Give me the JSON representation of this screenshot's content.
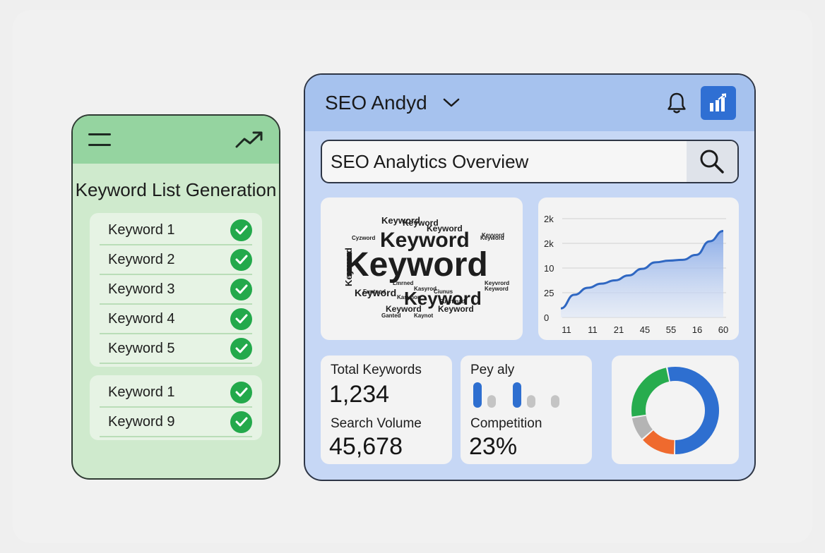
{
  "phone": {
    "title": "Keyword List Generation",
    "group1": [
      "Keyword 1",
      "Keyword 2",
      "Keyword 3",
      "Keyword 4",
      "Keyword 5"
    ],
    "group2": [
      "Keyword 1",
      "Keyword 9"
    ],
    "accent": "#95d4a0",
    "check_color": "#23a94b"
  },
  "dashboard": {
    "app_title": "SEO Andyd",
    "search_value": "SEO Analytics Overview",
    "word_cloud": {
      "main": "Keyword",
      "secondary": [
        "Keyword",
        "Keyword",
        "Keyword",
        "Keyword",
        "Keyword",
        "Keyword",
        "Keyword",
        "Keyword",
        "Keyword"
      ],
      "small": [
        "Cyzword",
        "Keyvord",
        "Ganted",
        "Keyword",
        "Keyvrord",
        "Keyword",
        "Lmrned",
        "Kasyrod",
        "Ciunus",
        "Funtnod",
        "Kasynor",
        "Fuyrtinad",
        "Kaynot"
      ]
    },
    "stats": {
      "total_keywords_label": "Total Keywords",
      "total_keywords_value": "1,234",
      "search_volume_label": "Search Volume",
      "search_volume_value": "45,678",
      "pay_label": "Pey aly",
      "competition_label": "Competition",
      "competition_value": "23%"
    },
    "accent": "#2f6fd3"
  },
  "chart_data": [
    {
      "type": "area",
      "y_tick_labels": [
        "2k",
        "2k",
        "10",
        "25",
        "0"
      ],
      "x": [
        "11",
        "11",
        "21",
        "45",
        "55",
        "16",
        "60"
      ],
      "values": [
        0.22,
        0.55,
        0.72,
        0.82,
        0.9,
        1.02,
        1.18,
        1.34,
        1.38,
        1.4,
        1.52,
        1.85,
        2.1
      ],
      "ylim": [
        0,
        2.4
      ],
      "grid": true,
      "color": "#2f67c2"
    },
    {
      "type": "pie",
      "values": [
        48,
        22,
        8,
        12
      ],
      "colors": [
        "#2e6fd0",
        "#27ac4e",
        "#b4b4b4",
        "#ef6a2e"
      ],
      "donut": true
    },
    {
      "type": "bar",
      "values": [
        1,
        0.35,
        1,
        0.35,
        0.35
      ],
      "colors": [
        "#2e6fd0",
        "#c4c4c4",
        "#2e6fd0",
        "#c4c4c4",
        "#c4c4c4"
      ]
    }
  ]
}
